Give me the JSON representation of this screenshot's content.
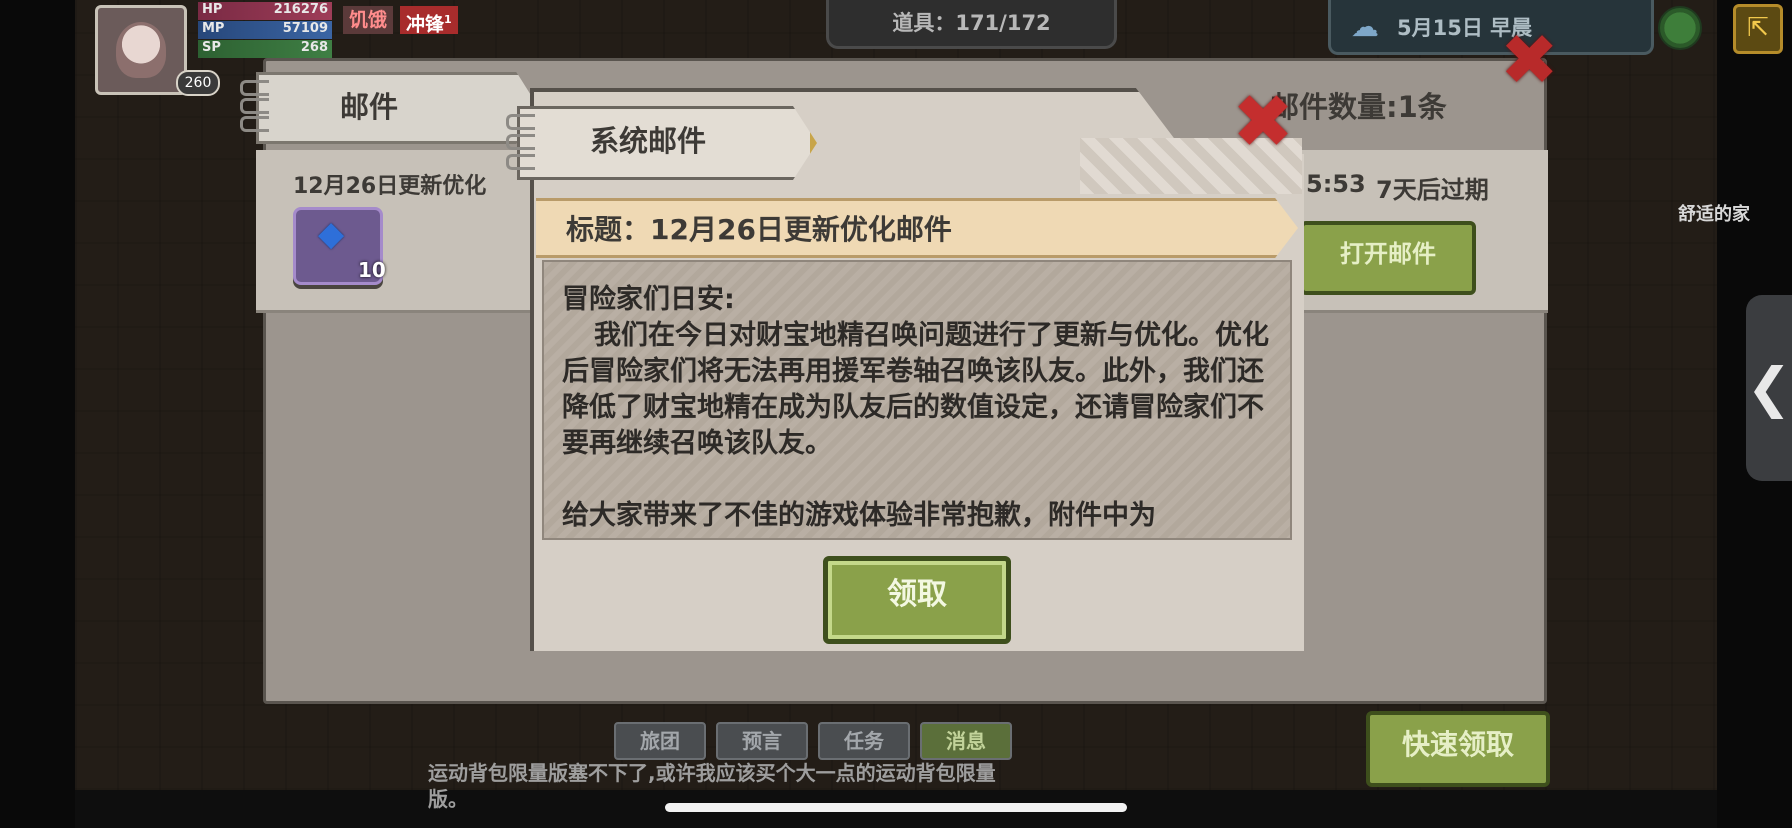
{
  "hud": {
    "level": "260",
    "stats": [
      {
        "label": "HP",
        "value": "216276"
      },
      {
        "label": "MP",
        "value": "57109"
      },
      {
        "label": "SP",
        "value": "268"
      }
    ],
    "status_hungry": "饥饿",
    "status_charge": "冲锋",
    "status_charge_count": "1",
    "items_count": "道具：171/172",
    "date_time": "5月15日 早晨",
    "place_label": "舒适的家",
    "side_tab_glyph": "❮"
  },
  "mail_window": {
    "tab_label": "邮件",
    "mail_count": "邮件数量:1条",
    "row": {
      "title": "12月26日更新优化",
      "time": "5:53",
      "expire": "7天后过期",
      "attachment_count": "10",
      "open_button": "打开邮件"
    }
  },
  "dialog": {
    "tab_label": "系统邮件",
    "subject": "标题：12月26日更新优化邮件",
    "body": {
      "greeting": "冒险家们日安:",
      "paragraph1": "我们在今日对财宝地精召唤问题进行了更新与优化。优化后冒险家们将无法再用援军卷轴召唤该队友。此外，我们还降低了财宝地精在成为队友后的数值设定，还请冒险家们不要再继续召唤该队友。",
      "paragraph2": "给大家带来了不佳的游戏体验非常抱歉，附件中为"
    },
    "claim_button": "领取",
    "close_glyph": "✖"
  },
  "bottom": {
    "tabs": [
      "旅团",
      "预言",
      "任务",
      "消息"
    ],
    "active_tab": "消息",
    "chat": "运动背包限量版塞不下了,或许我应该买个大一点的运动背包限量版。",
    "quick_claim": "快速领取"
  },
  "colors": {
    "accent_green": "#8aa14a",
    "close_red": "#c42e2e",
    "subject_banner": "#efd9b4"
  },
  "icons": [
    "gem-icon",
    "close-icon",
    "cloud-icon",
    "globe-icon",
    "exit-icon",
    "chevron-left-icon"
  ]
}
